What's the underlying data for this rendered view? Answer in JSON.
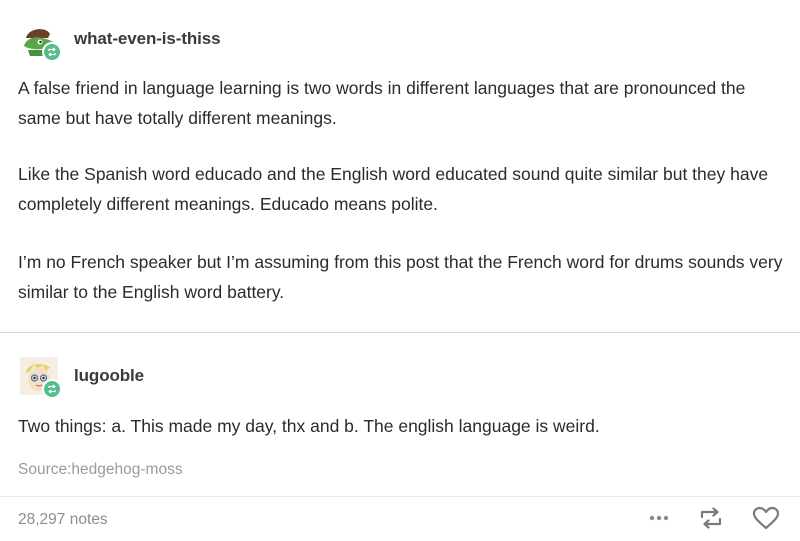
{
  "post": {
    "author": "what-even-is-thiss",
    "avatar_icon": "green-creature-avatar",
    "badge_icon": "reblog-icon",
    "paragraphs": [
      "A false friend in language learning is two words in different languages that are pronounced the same but have totally different meanings.",
      "Like the Spanish word educado and the English word educated sound quite similar but they have completely different meanings. Educado means polite.",
      "I’m no French speaker but I’m assuming from this post that the French word for drums sounds very similar to the English word battery."
    ]
  },
  "reblog": {
    "author": "lugooble",
    "avatar_icon": "cartoon-character-avatar",
    "badge_icon": "reblog-icon",
    "text": "Two things: a. This made my day, thx and b. The english language is weird."
  },
  "source": {
    "label": "Source:",
    "name": "hedgehog-moss"
  },
  "footer": {
    "notes": "28,297 notes",
    "icons": [
      "more-icon",
      "reblog-icon",
      "heart-icon"
    ]
  },
  "colors": {
    "badge": "#56bc8a",
    "text": "#2b2b2b",
    "muted": "#9a9a9a",
    "divider": "#d6d6d6"
  }
}
